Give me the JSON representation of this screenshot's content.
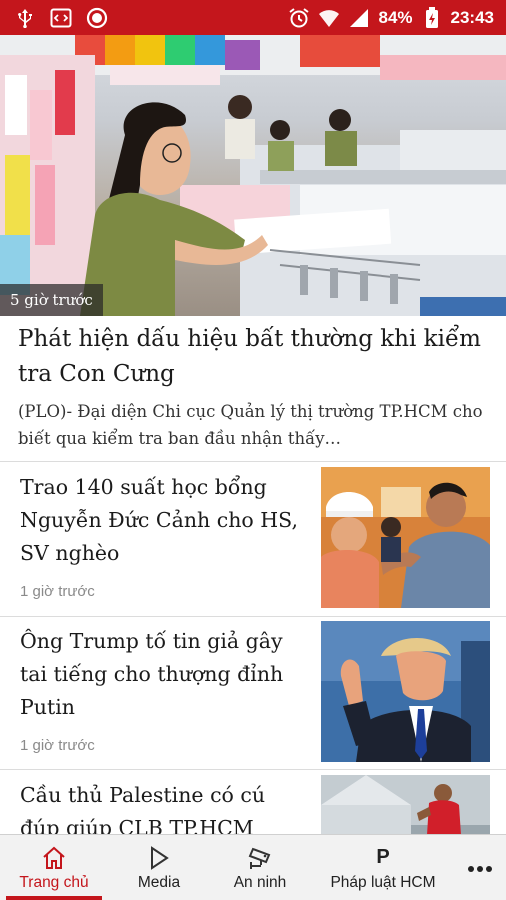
{
  "status_bar": {
    "battery": "84%",
    "time": "23:43",
    "left_icons": [
      "usb-icon",
      "code-icon",
      "record-icon"
    ],
    "right_icons": [
      "alarm-icon",
      "wifi-icon",
      "signal-icon",
      "battery-icon"
    ]
  },
  "lead_article": {
    "time": "5 giờ trước",
    "title": "Phát hiện dấu hiệu bất thường khi kiểm tra Con Cưng",
    "summary": "(PLO)- Đại diện Chi cục Quản lý thị trường TP.HCM cho biết qua kiểm tra ban đầu nhận thấy…"
  },
  "articles": [
    {
      "title": "Trao 140 suất học bổng Nguyễn Đức Cảnh cho HS, SV nghèo",
      "time": "1 giờ trước"
    },
    {
      "title": "Ông Trump tố tin giả gây tai tiếng cho thượng đỉnh Putin",
      "time": "1 giờ trước"
    },
    {
      "title": "Cầu thủ Palestine có cú đúp giúp CLB TP.HCM",
      "time": ""
    }
  ],
  "bottom_nav": {
    "items": [
      {
        "label": "Trang chủ",
        "icon": "home-icon",
        "active": true
      },
      {
        "label": "Media",
        "icon": "play-icon",
        "active": false
      },
      {
        "label": "An ninh",
        "icon": "cctv-icon",
        "active": false
      },
      {
        "label": "Pháp luật HCM",
        "icon": "p-letter-icon",
        "icon_text": "P",
        "active": false
      }
    ],
    "more_icon": "more-dots-icon"
  },
  "colors": {
    "brand": "#c4161c",
    "nav_bg": "#f2f2f2",
    "meta_text": "#8a8a8a"
  }
}
